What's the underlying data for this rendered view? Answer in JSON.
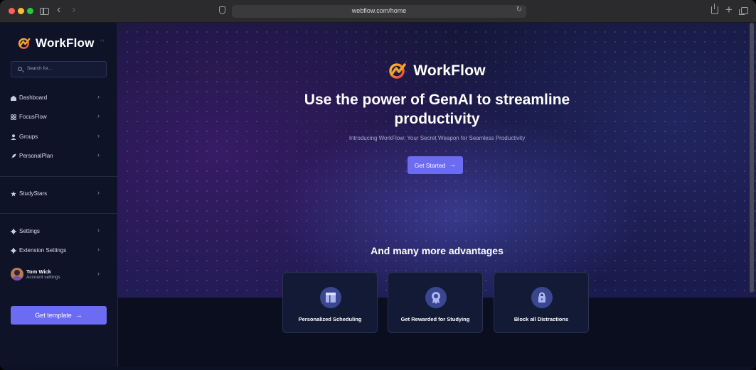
{
  "browser": {
    "url": "webflow.com/home"
  },
  "sidebar": {
    "brand": "WorkFlow",
    "collapse_glyph": "‹›",
    "search_placeholder": "Search for...",
    "nav_primary": [
      {
        "label": "Dashboard",
        "icon": "home-icon"
      },
      {
        "label": "FocusFlow",
        "icon": "grid-icon"
      },
      {
        "label": "Groups",
        "icon": "user-icon"
      },
      {
        "label": "PersonalPlan",
        "icon": "rocket-icon"
      }
    ],
    "nav_secondary": [
      {
        "label": "StudyStars",
        "icon": "star-icon"
      }
    ],
    "nav_settings": [
      {
        "label": "Settings",
        "icon": "gear-icon"
      },
      {
        "label": "Extension Settings",
        "icon": "gear-icon"
      }
    ],
    "user": {
      "name": "Tom Wick",
      "subtitle": "Account settings"
    },
    "cta": "Get template"
  },
  "hero": {
    "brand": "WorkFlow",
    "headline": "Use the power of GenAI to streamline productivity",
    "subheadline": "Introducing WorkFlow: Your Secret Weapon for Seamless Productivity",
    "cta": "Get Started"
  },
  "advantages": {
    "title": "And many more advantages",
    "cards": [
      {
        "label": "Personalized Scheduling",
        "icon": "layout-icon"
      },
      {
        "label": "Get Rewarded for Studying",
        "icon": "award-icon"
      },
      {
        "label": "Block all Distractions",
        "icon": "lock-icon"
      }
    ]
  },
  "colors": {
    "accent": "#6c6cf2",
    "sidebar_bg": "#0e1327",
    "logo_orange": "#f5a524",
    "logo_red": "#e8433b"
  }
}
